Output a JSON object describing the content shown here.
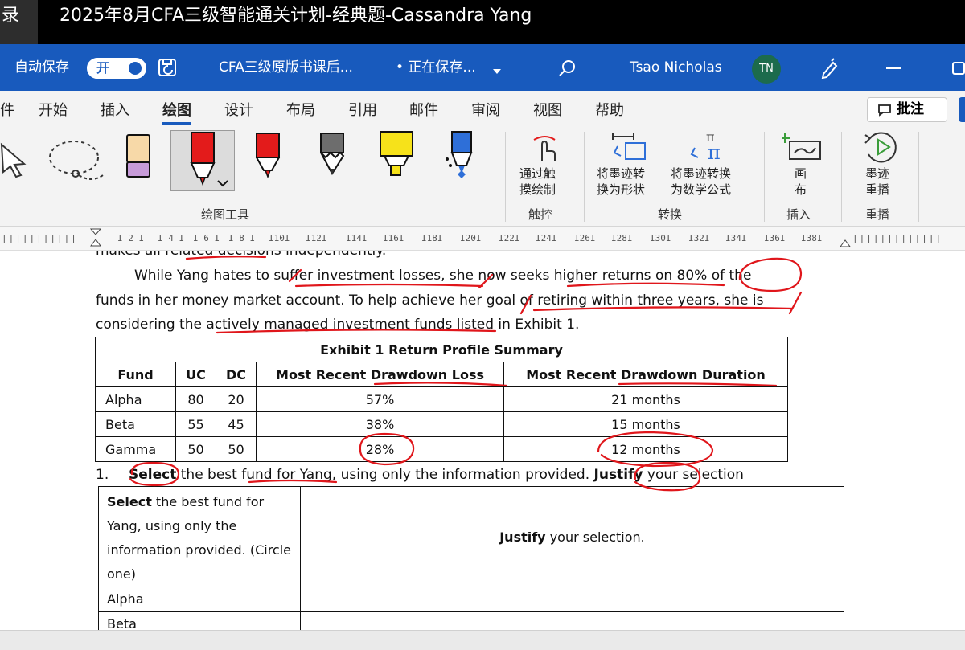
{
  "window": {
    "left_tag": "录",
    "title": "2025年8月CFA三级智能通关计划-经典题-Cassandra Yang"
  },
  "word": {
    "autosave_label": "自动保存",
    "autosave_state": "开",
    "doc_title": "CFA三级原版书课后...",
    "saving_status": "• 正在保存...",
    "user_name": "Tsao Nicholas",
    "user_initials": "TN",
    "accent": "#185abd"
  },
  "tabs": [
    "件",
    "开始",
    "插入",
    "绘图",
    "设计",
    "布局",
    "引用",
    "邮件",
    "审阅",
    "视图",
    "帮助"
  ],
  "active_tab": "绘图",
  "comment_label": "批注",
  "ribbon": {
    "group_draw": "绘图工具",
    "group_touch": "触控",
    "group_convert": "转换",
    "group_insert": "插入",
    "group_replay": "重播",
    "touch_draw": [
      "通过触",
      "摸绘制"
    ],
    "ink_shape": [
      "将墨迹转",
      "换为形状"
    ],
    "ink_math": [
      "将墨迹转换",
      "为数学公式"
    ],
    "canvas": [
      "画",
      "布"
    ],
    "ink_replay": [
      "墨迹",
      "重播"
    ]
  },
  "ruler": [
    "I 2 I",
    "I 4 I",
    "I 6 I",
    "I 8 I",
    "I10I",
    "I12I",
    "I14I",
    "I16I",
    "I18I",
    "I20I",
    "I22I",
    "I24I",
    "I26I",
    "I28I",
    "I30I",
    "I32I",
    "I34I",
    "I36I",
    "I38I"
  ],
  "doc": {
    "cut_line": "makes all related decisions independently.",
    "para_line1": "While Yang hates to suffer investment losses, she now seeks higher returns on 80% of the",
    "para_line2": "funds in her money market account. To help achieve her goal of retiring within three years, she is",
    "para_line3": "considering the actively managed investment funds listed in Exhibit 1.",
    "exhibit": {
      "title": "Exhibit 1 Return Profile Summary",
      "headers": [
        "Fund",
        "UC",
        "DC",
        "Most Recent Drawdown Loss",
        "Most Recent Drawdown Duration"
      ],
      "rows": [
        [
          "Alpha",
          "80",
          "20",
          "57%",
          "21 months"
        ],
        [
          "Beta",
          "55",
          "45",
          "38%",
          "15 months"
        ],
        [
          "Gamma",
          "50",
          "50",
          "28%",
          "12 months"
        ]
      ]
    },
    "question": {
      "number": "1.",
      "bold1": "Select",
      "text1": " the best fund for Yang, using only the information provided. ",
      "bold2": "Justify",
      "text2": " your selection"
    },
    "answer_table": {
      "left_bold": "Select",
      "left_text": " the best fund for Yang, using only the information provided. (Circle one)",
      "right_bold": "Justify",
      "right_text": " your selection.",
      "options": [
        "Alpha",
        "Beta"
      ]
    }
  },
  "ink_color": "#e0161b"
}
